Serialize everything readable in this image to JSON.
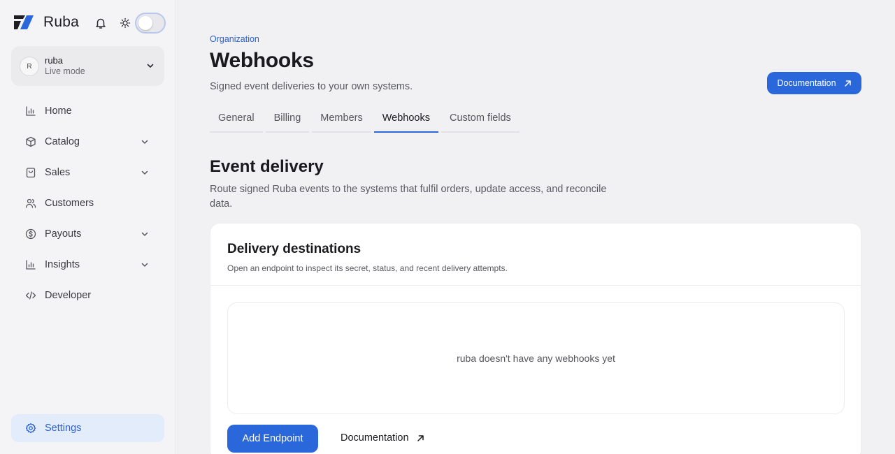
{
  "brand": {
    "name": "Ruba",
    "logo_icon": "ruba-logo-icon"
  },
  "header_icons": {
    "bell": "bell-icon",
    "theme": "sun-icon",
    "toggle": "theme-toggle"
  },
  "org": {
    "initial": "R",
    "name": "ruba",
    "mode": "Live mode"
  },
  "sidebar": {
    "items": [
      {
        "label": "Home",
        "icon": "chart-icon",
        "expandable": false
      },
      {
        "label": "Catalog",
        "icon": "box-icon",
        "expandable": true
      },
      {
        "label": "Sales",
        "icon": "bag-icon",
        "expandable": true
      },
      {
        "label": "Customers",
        "icon": "users-icon",
        "expandable": false
      },
      {
        "label": "Payouts",
        "icon": "dollar-circle-icon",
        "expandable": true
      },
      {
        "label": "Insights",
        "icon": "chart-icon",
        "expandable": true
      },
      {
        "label": "Developer",
        "icon": "code-icon",
        "expandable": false
      }
    ],
    "settings_label": "Settings"
  },
  "page": {
    "breadcrumb": "Organization",
    "title": "Webhooks",
    "subtitle": "Signed event deliveries to your own systems.",
    "doc_button": "Documentation"
  },
  "tabs": [
    {
      "label": "General",
      "active": false
    },
    {
      "label": "Billing",
      "active": false
    },
    {
      "label": "Members",
      "active": false
    },
    {
      "label": "Webhooks",
      "active": true
    },
    {
      "label": "Custom fields",
      "active": false
    }
  ],
  "section": {
    "title": "Event delivery",
    "subtitle": "Route signed Ruba events to the systems that fulfil orders, update access, and reconcile data."
  },
  "card": {
    "title": "Delivery destinations",
    "subtitle": "Open an endpoint to inspect its secret, status, and recent delivery attempts.",
    "empty_text": "ruba doesn't have any webhooks yet",
    "add_button": "Add Endpoint",
    "doc_link": "Documentation"
  },
  "colors": {
    "accent": "#2a67da",
    "background": "#f1f1f3",
    "card": "#ffffff"
  }
}
